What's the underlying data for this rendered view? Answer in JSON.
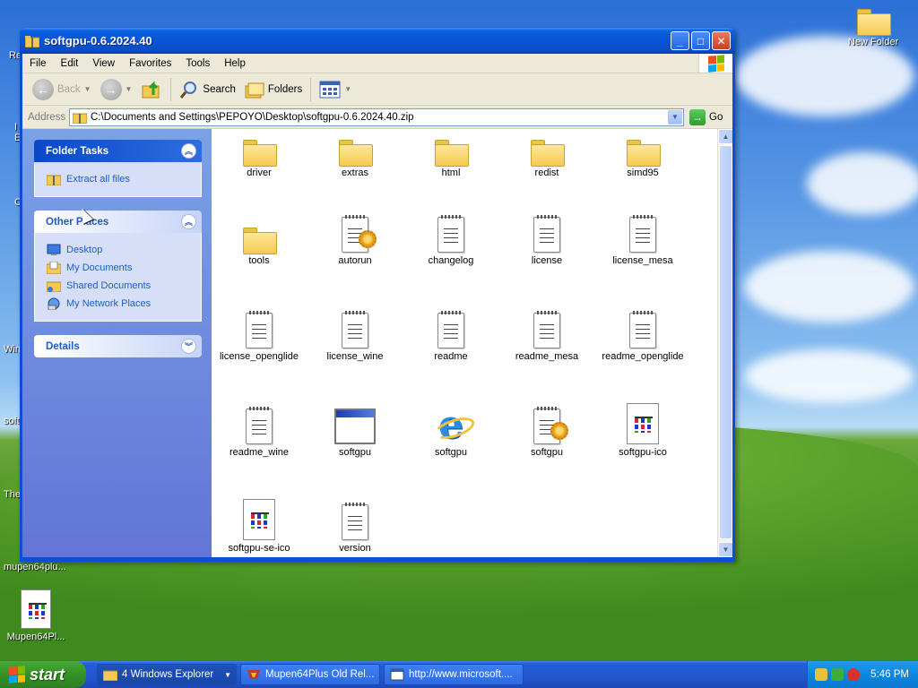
{
  "desktop": {
    "icons": [
      {
        "label": "New Folder",
        "type": "folder"
      },
      {
        "label": "mupen64plu...",
        "type": "folder"
      },
      {
        "label": "Mupen64Pl...",
        "type": "icofile"
      }
    ],
    "left_fragments": [
      "Re",
      "I",
      "E",
      "C",
      "Win",
      "soft",
      "The"
    ]
  },
  "window": {
    "title": "softgpu-0.6.2024.40",
    "buttons": {
      "minimize": "_",
      "maximize": "□",
      "close": "✕"
    },
    "menu": [
      "File",
      "Edit",
      "View",
      "Favorites",
      "Tools",
      "Help"
    ],
    "toolbar": {
      "back": "Back",
      "search": "Search",
      "folders": "Folders"
    },
    "address": {
      "label": "Address",
      "value": "C:\\Documents and Settings\\PEPOYO\\Desktop\\softgpu-0.6.2024.40.zip",
      "go": "Go"
    },
    "tasks": {
      "folder_tasks": {
        "title": "Folder Tasks",
        "items": [
          "Extract all files"
        ]
      },
      "other_places": {
        "title": "Other Places",
        "items": [
          "Desktop",
          "My Documents",
          "Shared Documents",
          "My Network Places"
        ]
      },
      "details": {
        "title": "Details"
      }
    },
    "files": [
      {
        "name": "driver",
        "type": "folder"
      },
      {
        "name": "extras",
        "type": "folder"
      },
      {
        "name": "html",
        "type": "folder"
      },
      {
        "name": "redist",
        "type": "folder"
      },
      {
        "name": "simd95",
        "type": "folder"
      },
      {
        "name": "tools",
        "type": "folder"
      },
      {
        "name": "autorun",
        "type": "config"
      },
      {
        "name": "changelog",
        "type": "text"
      },
      {
        "name": "license",
        "type": "text"
      },
      {
        "name": "license_mesa",
        "type": "text"
      },
      {
        "name": "license_openglide",
        "type": "text"
      },
      {
        "name": "license_wine",
        "type": "text"
      },
      {
        "name": "readme",
        "type": "text"
      },
      {
        "name": "readme_mesa",
        "type": "text"
      },
      {
        "name": "readme_openglide",
        "type": "text"
      },
      {
        "name": "readme_wine",
        "type": "text"
      },
      {
        "name": "softgpu",
        "type": "app"
      },
      {
        "name": "softgpu",
        "type": "ie"
      },
      {
        "name": "softgpu",
        "type": "config"
      },
      {
        "name": "softgpu-ico",
        "type": "icofile"
      },
      {
        "name": "softgpu-se-ico",
        "type": "icofile"
      },
      {
        "name": "version",
        "type": "text"
      }
    ]
  },
  "taskbar": {
    "start": "start",
    "buttons": [
      {
        "label": "4 Windows Explorer",
        "active": true
      },
      {
        "label": "Mupen64Plus Old Rel...",
        "active": false
      },
      {
        "label": "http://www.microsoft....",
        "active": false
      }
    ],
    "clock": "5:46 PM"
  }
}
